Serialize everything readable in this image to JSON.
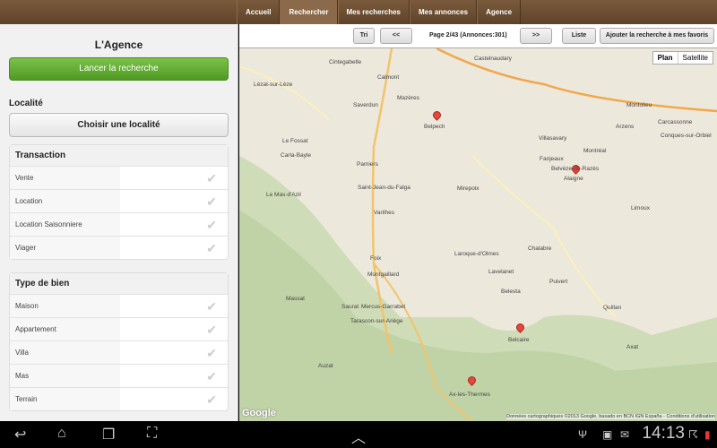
{
  "tabs": [
    "Accueil",
    "Rechercher",
    "Mes recherches",
    "Mes annonces",
    "Agence"
  ],
  "left": {
    "title": "L'Agence",
    "search_button": "Lancer la recherche",
    "locality_label": "Localité",
    "locality_button": "Choisir une localité",
    "transaction": {
      "title": "Transaction",
      "items": [
        "Vente",
        "Location",
        "Location Saisonniere",
        "Viager"
      ]
    },
    "property_type": {
      "title": "Type de bien",
      "items": [
        "Maison",
        "Appartement",
        "Villa",
        "Mas",
        "Terrain"
      ]
    }
  },
  "mapbar": {
    "sort": "Tri",
    "prev": "<<",
    "page_info": "Page 2/43 (Annonces:301)",
    "next": ">>",
    "list": "Liste",
    "favorite": "Ajouter la recherche à mes favoris"
  },
  "map": {
    "type_plan": "Plan",
    "type_satellite": "Satellite",
    "attribution": "Données cartographiques ©2013 Google, basado en BCN IGN España - Conditions d'utilisation",
    "logo": "Google",
    "towns": [
      "Cintegabelle",
      "Castelnaudary",
      "Calmont",
      "Lézat-sur-Lèze",
      "Mazères",
      "Saverdun",
      "Belpech",
      "Villasavary",
      "Montréal",
      "Carcassonne",
      "Le Fossat",
      "Fanjeaux",
      "Arzens",
      "Carla-Bayle",
      "Pamiers",
      "Belvèze-du-Razès",
      "Alaigne",
      "Saint-Jean-du-Falga",
      "Mirepoix",
      "Le Mas-d'Azil",
      "Varilhes",
      "Limoux",
      "Foix",
      "Laroque-d'Olmes",
      "Chalabre",
      "Lavelanet",
      "Montgaillard",
      "Belesta",
      "Puivert",
      "Massat",
      "Quillan",
      "Saurat",
      "Mercus-Garrabet",
      "Tarascon-sur-Ariège",
      "Belcaire",
      "Axat",
      "Auzat",
      "Ax-les-Thermes",
      "Montolieu",
      "Conques-sur-Orbiel"
    ]
  },
  "status": {
    "time": "14:13"
  }
}
